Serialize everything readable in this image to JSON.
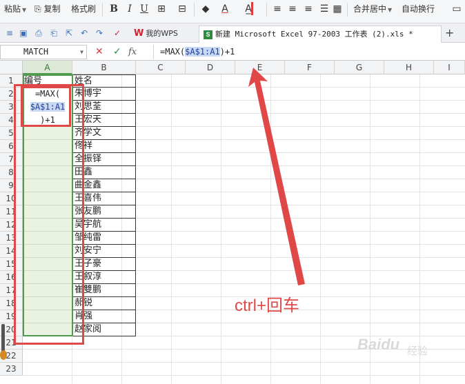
{
  "ribbon": {
    "paste": "粘贴",
    "copy": "复制",
    "format_painter": "格式刷",
    "bold": "B",
    "italic": "I",
    "underline": "U",
    "font_color_letter": "A",
    "merge_center": "合并居中",
    "wrap_text": "自动换行"
  },
  "tabs": [
    {
      "label": "我的WPS",
      "logo": "W"
    },
    {
      "label": "新建 Microsoft Excel 97-2003 工作表 (2).xls *",
      "logo": "S"
    }
  ],
  "add_tab": "+",
  "formula_bar": {
    "name_box": "MATCH",
    "cancel": "✕",
    "confirm": "✓",
    "fx": "fx",
    "formula_prefix": "=MAX(",
    "formula_ref": "$A$1:A1",
    "formula_suffix": ")+1"
  },
  "columns": [
    "A",
    "B",
    "C",
    "D",
    "E",
    "F",
    "G",
    "H",
    "I"
  ],
  "rows": [
    "1",
    "2",
    "3",
    "4",
    "5",
    "6",
    "7",
    "8",
    "9",
    "10",
    "11",
    "12",
    "13",
    "14",
    "15",
    "16",
    "17",
    "18",
    "19",
    "20",
    "21",
    "22",
    "23"
  ],
  "cells": {
    "A1": "编号",
    "B1": "姓名",
    "names": [
      "朱博宇",
      "刘思荃",
      "王宏天",
      "齐学文",
      "佟祥",
      "全振铎",
      "田鑫",
      "曲金鑫",
      "王喜伟",
      "张友鹏",
      "吴宇航",
      "邹纯雷",
      "刘安宁",
      "王子豪",
      "王叙淳",
      "崔雙鹏",
      "郝锐",
      "肖强",
      "赵家阅"
    ]
  },
  "editor": {
    "line1": "=MAX(",
    "line2": "$A$1:A1",
    "line3": ")+1"
  },
  "annotation": "ctrl+回车",
  "watermark": {
    "brand": "Baidu",
    "text": "经验"
  },
  "colors": {
    "annotation_red": "#e04848",
    "selection_green": "#4f9a4c",
    "ref_highlight": "#c9d9f1"
  }
}
